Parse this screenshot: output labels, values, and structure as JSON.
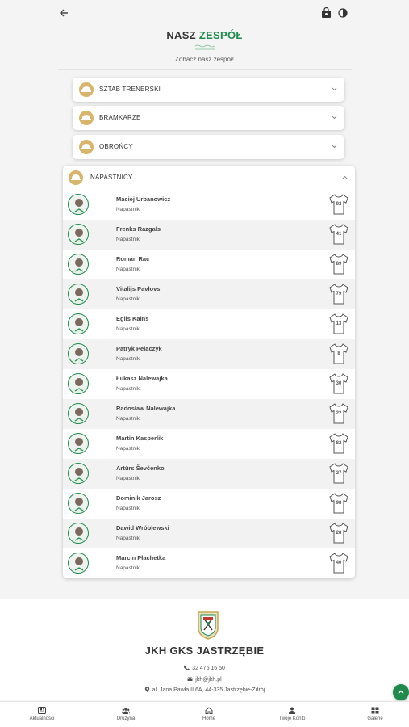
{
  "header": {
    "title_part1": "NASZ",
    "title_part2": "ZESPÓŁ",
    "subtitle": "Zobacz nasz zespół!"
  },
  "sections": [
    {
      "label": "SZTAB TRENERSKI"
    },
    {
      "label": "BRAMKARZE"
    },
    {
      "label": "OBROŃCY"
    },
    {
      "label": "NAPASTNICY"
    }
  ],
  "players": [
    {
      "name": "Maciej Urbanowicz",
      "role": "Napastnik",
      "number": "92"
    },
    {
      "name": "Frenks Razgals",
      "role": "Napastnik",
      "number": "41"
    },
    {
      "name": "Roman Rac",
      "role": "Napastnik",
      "number": "89"
    },
    {
      "name": "Vitalijs Pavlovs",
      "role": "Napastnik",
      "number": "79"
    },
    {
      "name": "Egils Kalns",
      "role": "Napastnik",
      "number": "13"
    },
    {
      "name": "Patryk Pelaczyk",
      "role": "Napastnik",
      "number": "8"
    },
    {
      "name": "Łukasz Nalewajka",
      "role": "Napastnik",
      "number": "30"
    },
    {
      "name": "Radosław Nalewajka",
      "role": "Napastnik",
      "number": "22"
    },
    {
      "name": "Martin Kasperlik",
      "role": "Napastnik",
      "number": "82"
    },
    {
      "name": "Artūrs Ševčenko",
      "role": "Napastnik",
      "number": "27"
    },
    {
      "name": "Dominik Jarosz",
      "role": "Napastnik",
      "number": "98"
    },
    {
      "name": "Dawid Wróblewski",
      "role": "Napastnik",
      "number": "28"
    },
    {
      "name": "Marcin Płachetka",
      "role": "Napastnik",
      "number": "40"
    }
  ],
  "footer": {
    "club_name": "JKH GKS JASTRZĘBIE",
    "phone": "32 476 16 50",
    "email": "jkh@jkh.pl",
    "address": "al. Jana Pawła II 6A, 44-335 Jastrzębie-Zdrój"
  },
  "nav": [
    {
      "label": "Aktualności",
      "icon": "news-icon"
    },
    {
      "label": "Drużyna",
      "icon": "team-icon"
    },
    {
      "label": "Home",
      "icon": "home-icon"
    },
    {
      "label": "Twoje Konto",
      "icon": "user-icon"
    },
    {
      "label": "Galerie",
      "icon": "gallery-icon"
    }
  ],
  "colors": {
    "accent": "#1f8a4c",
    "gold": "#d7b56a"
  },
  "icons": {
    "top": [
      "back-arrow-icon",
      "shopping-bag-icon",
      "contrast-icon"
    ],
    "section": "cap-icon",
    "scroll_top": "chevron-up-icon"
  }
}
